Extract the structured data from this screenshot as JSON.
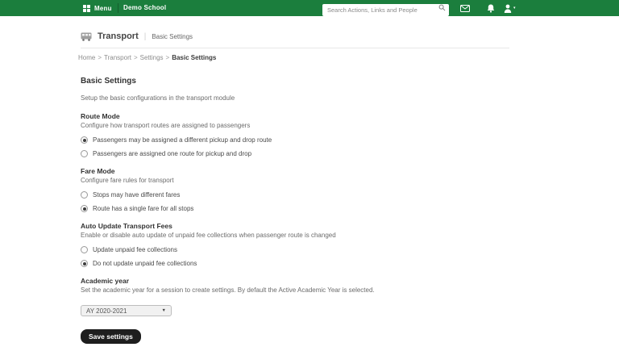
{
  "topbar": {
    "menu_label": "Menu",
    "school_name": "Demo School",
    "search_placeholder": "Search Actions, Links and People",
    "bar_color": "#1b7e3d"
  },
  "module_header": {
    "title": "Transport",
    "pipe": "|",
    "subtitle": "Basic Settings"
  },
  "breadcrumb": {
    "separator": ">",
    "items": [
      "Home",
      "Transport",
      "Settings"
    ],
    "current": "Basic Settings"
  },
  "page": {
    "title": "Basic Settings",
    "description": "Setup the basic configurations in the transport module"
  },
  "sections": [
    {
      "label": "Route Mode",
      "description": "Configure how transport routes are assigned to passengers",
      "options": [
        {
          "label": "Passengers may be assigned a different pickup and drop route",
          "selected": true
        },
        {
          "label": "Passengers are assigned one route for pickup and drop",
          "selected": false
        }
      ]
    },
    {
      "label": "Fare Mode",
      "description": "Configure fare rules for transport",
      "options": [
        {
          "label": "Stops may have different fares",
          "selected": false
        },
        {
          "label": "Route has a single fare for all stops",
          "selected": true
        }
      ]
    },
    {
      "label": "Auto Update Transport Fees",
      "description": "Enable or disable auto update of unpaid fee collections when passenger route is changed",
      "options": [
        {
          "label": "Update unpaid fee collections",
          "selected": false
        },
        {
          "label": "Do not update unpaid fee collections",
          "selected": true
        }
      ]
    }
  ],
  "academic_year": {
    "label": "Academic year",
    "description": "Set the academic year for a session to create settings. By default the Active Academic Year is selected.",
    "selected_option": "AY 2020-2021",
    "dropdown_arrow": "▼"
  },
  "save_button_label": "Save settings"
}
